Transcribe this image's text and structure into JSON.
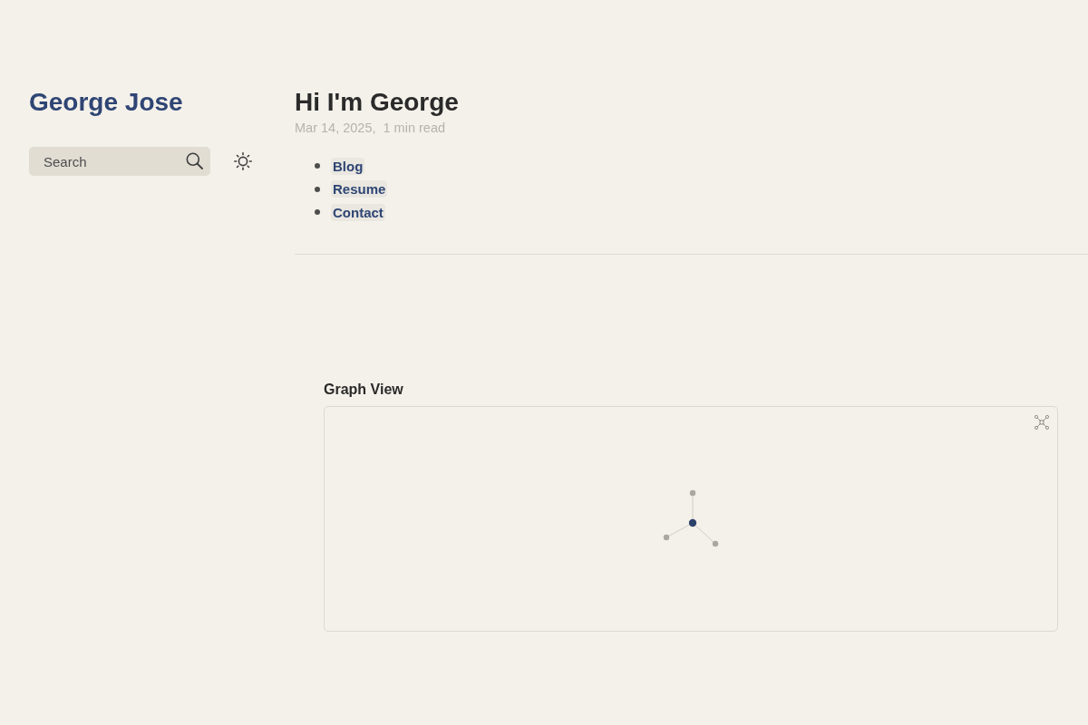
{
  "sidebar": {
    "site_title": "George Jose",
    "search": {
      "placeholder": "Search"
    }
  },
  "article": {
    "title": "Hi I'm George",
    "meta": "Mar 14, 2025,  1 min read",
    "links": [
      {
        "label": "Blog"
      },
      {
        "label": "Resume"
      },
      {
        "label": "Contact"
      }
    ]
  },
  "graph_view": {
    "title": "Graph View"
  }
}
